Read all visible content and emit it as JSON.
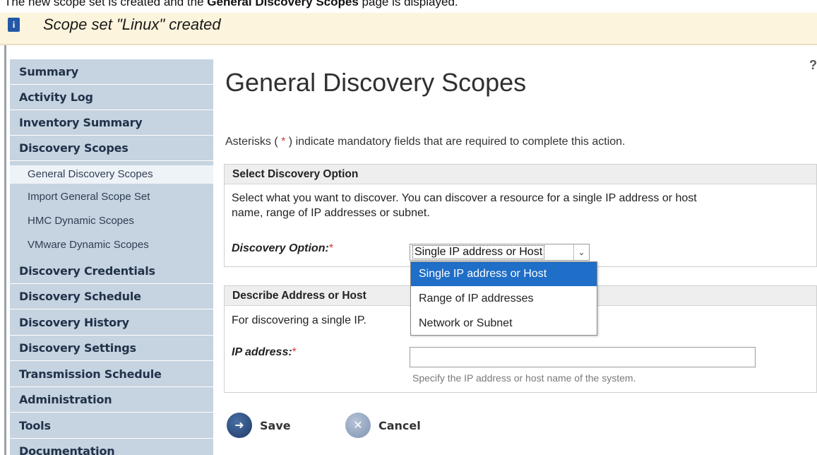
{
  "caption": {
    "before": "The new scope set is created and the ",
    "bold": "General Discovery Scopes",
    "after": " page is displayed."
  },
  "banner": {
    "message": "Scope set \"Linux\" created",
    "icon": "info-icon"
  },
  "sidebar": {
    "items": [
      {
        "label": "Summary"
      },
      {
        "label": "Activity Log"
      },
      {
        "label": "Inventory Summary"
      },
      {
        "label": "Discovery Scopes"
      },
      {
        "label": "General Discovery Scopes"
      },
      {
        "label": "Import General Scope Set"
      },
      {
        "label": "HMC Dynamic Scopes"
      },
      {
        "label": "VMware Dynamic Scopes"
      },
      {
        "label": "Discovery Credentials"
      },
      {
        "label": "Discovery Schedule"
      },
      {
        "label": "Discovery History"
      },
      {
        "label": "Discovery Settings"
      },
      {
        "label": "Transmission Schedule"
      },
      {
        "label": "Administration"
      },
      {
        "label": "Tools"
      },
      {
        "label": "Documentation"
      }
    ]
  },
  "help": {
    "glyph": "?"
  },
  "main": {
    "title": "General Discovery Scopes",
    "note_prefix": "Asterisks ( ",
    "note_star": "*",
    "note_suffix": " ) indicate mandatory fields that are required to complete this action."
  },
  "select_option": {
    "heading": "Select Discovery Option",
    "description_line1": "Select what you want to discover. You can discover a resource for a single IP address or host",
    "description_line2": "name, range of IP addresses or subnet.",
    "field_label": "Discovery Option:",
    "required_mark": "*",
    "selected_value": "Single IP address or Host",
    "options": [
      {
        "label": "Single IP address or Host",
        "selected": true
      },
      {
        "label": "Range of IP addresses",
        "selected": false
      },
      {
        "label": "Network or Subnet",
        "selected": false
      }
    ]
  },
  "describe": {
    "heading": "Describe Address or Host",
    "description": "For discovering a single IP.",
    "field_label": "IP address:",
    "required_mark": "*",
    "ip_value": "",
    "hint": "Specify the IP address or host name of the system."
  },
  "actions": {
    "save_label": "Save",
    "cancel_label": "Cancel"
  },
  "colors": {
    "accent": "#1f6ec7",
    "sidebar": "#c6d3e0",
    "banner": "#fcf4dc",
    "required": "#d23b2b"
  }
}
